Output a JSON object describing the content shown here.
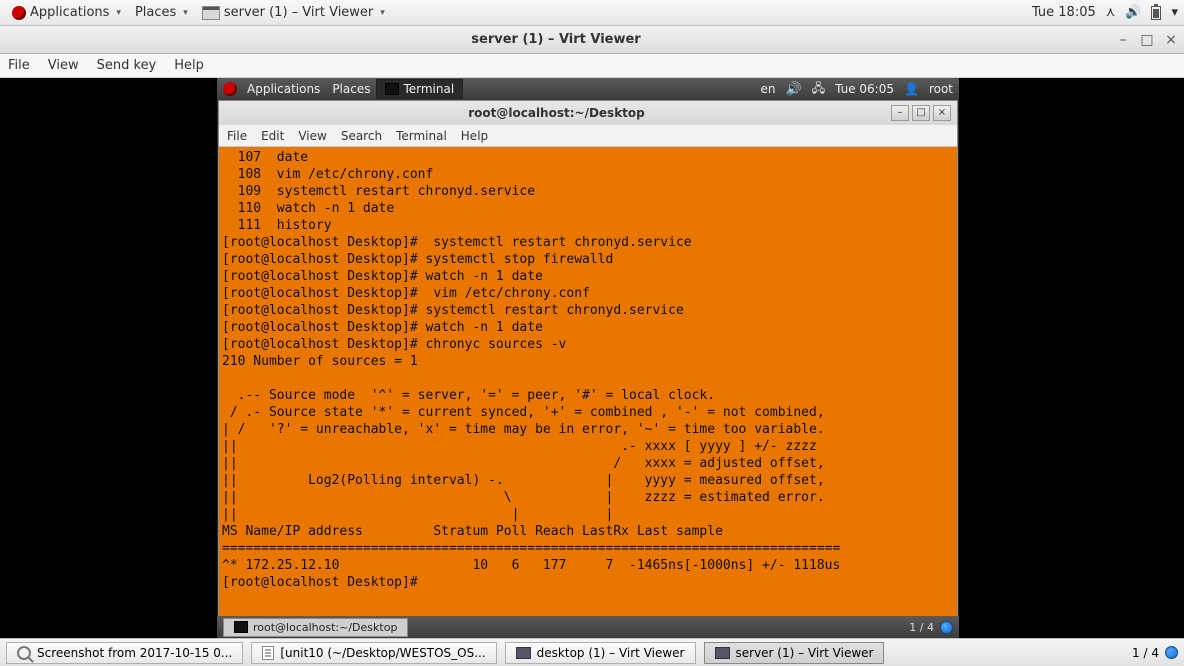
{
  "host": {
    "applications": "Applications",
    "places": "Places",
    "running_app": "server (1) – Virt Viewer",
    "clock": "Tue 18:05"
  },
  "virt": {
    "title": "server (1) – Virt Viewer",
    "menus": {
      "file": "File",
      "view": "View",
      "sendkey": "Send key",
      "help": "Help"
    }
  },
  "guest": {
    "applications": "Applications",
    "places": "Places",
    "terminal_tab": "Terminal",
    "lang": "en",
    "clock": "Tue 06:05",
    "user": "root",
    "task": "root@localhost:~/Desktop",
    "workspace": "1 / 4"
  },
  "terminal": {
    "title": "root@localhost:~/Desktop",
    "menus": {
      "file": "File",
      "edit": "Edit",
      "view": "View",
      "search": "Search",
      "terminal": "Terminal",
      "help": "Help"
    },
    "content": "  107  date\n  108  vim /etc/chrony.conf\n  109  systemctl restart chronyd.service\n  110  watch -n 1 date\n  111  history\n[root@localhost Desktop]#  systemctl restart chronyd.service\n[root@localhost Desktop]# systemctl stop firewalld\n[root@localhost Desktop]# watch -n 1 date\n[root@localhost Desktop]#  vim /etc/chrony.conf\n[root@localhost Desktop]# systemctl restart chronyd.service\n[root@localhost Desktop]# watch -n 1 date\n[root@localhost Desktop]# chronyc sources -v\n210 Number of sources = 1\n\n  .-- Source mode  '^' = server, '=' = peer, '#' = local clock.\n / .- Source state '*' = current synced, '+' = combined , '-' = not combined,\n| /   '?' = unreachable, 'x' = time may be in error, '~' = time too variable.\n||                                                 .- xxxx [ yyyy ] +/- zzzz\n||                                                /   xxxx = adjusted offset,\n||         Log2(Polling interval) -.             |    yyyy = measured offset,\n||                                  \\            |    zzzz = estimated error.\n||                                   |           |\nMS Name/IP address         Stratum Poll Reach LastRx Last sample\n===============================================================================\n^* 172.25.12.10                 10   6   177     7  -1465ns[-1000ns] +/- 1118us\n[root@localhost Desktop]# "
  },
  "host_tasks": {
    "screenshot": "Screenshot from 2017-10-15 0...",
    "unit10": "[unit10 (~/Desktop/WESTOS_OS...",
    "desktop1": "desktop (1) – Virt Viewer",
    "server1": "server (1) – Virt Viewer",
    "workspace": "1 / 4"
  }
}
